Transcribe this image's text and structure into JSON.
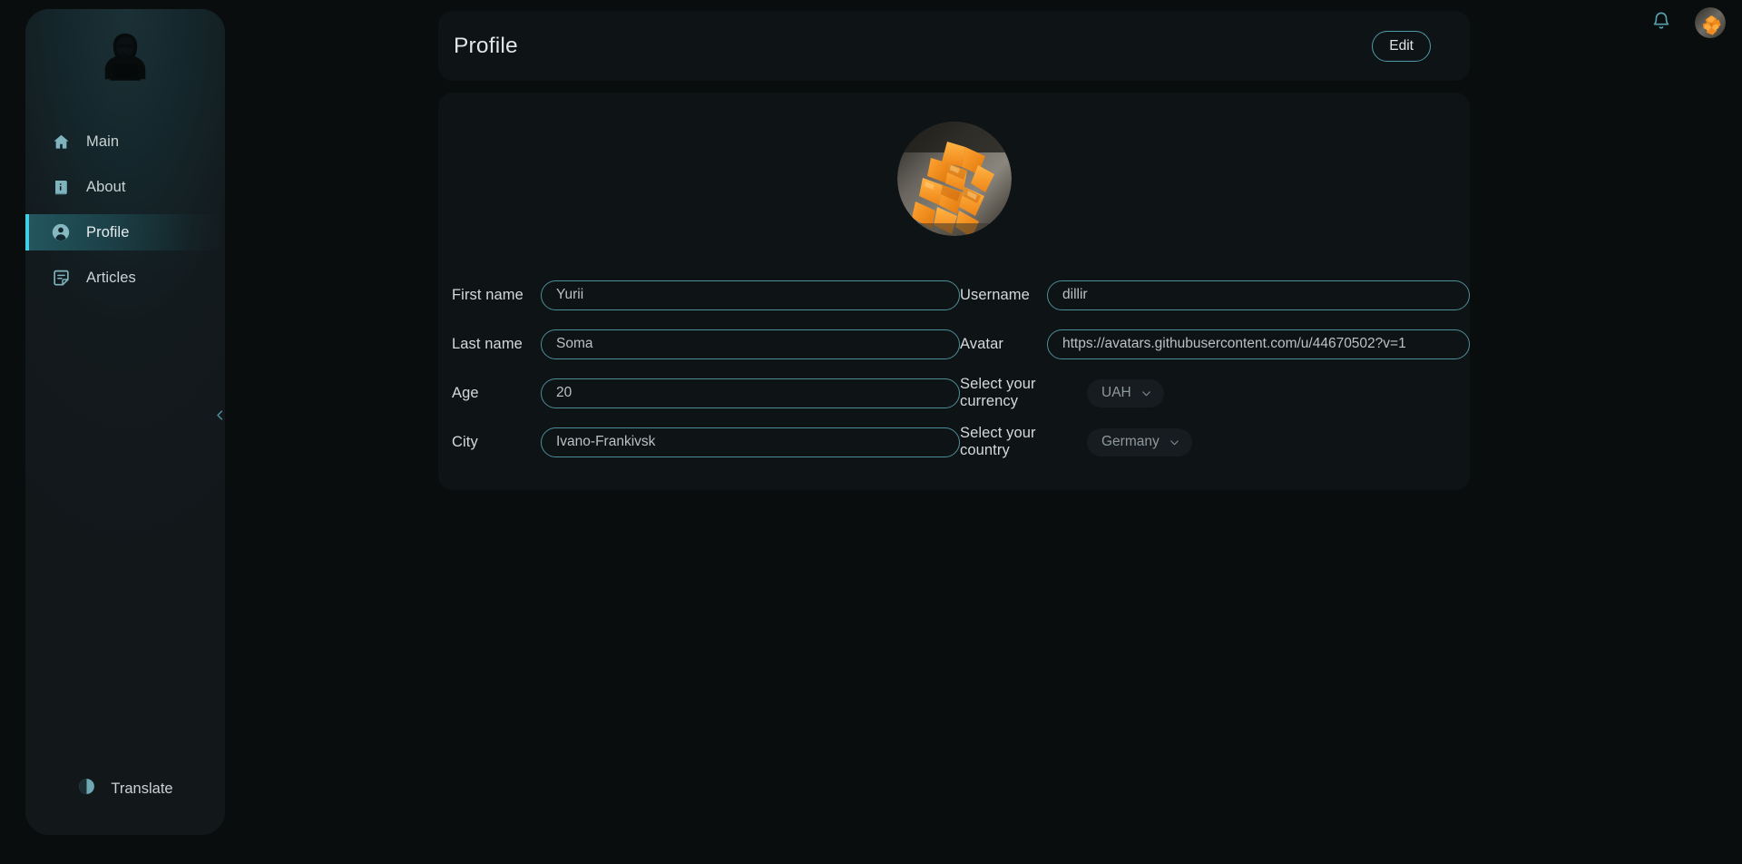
{
  "theme": {
    "bg": "#0a0d0e",
    "card_bg": "#0e1315",
    "accent": "#4e9aa8",
    "accent_bright": "#3fd0e8",
    "input_border": "#4e8e99",
    "text": "#dfe6e8",
    "muted_text": "#8e999c"
  },
  "sidebar": {
    "logo_icon": "hacker-hoodie-laptop-icon",
    "items": [
      {
        "label": "Main",
        "icon": "home-icon",
        "active": false
      },
      {
        "label": "About",
        "icon": "info-book-icon",
        "active": false
      },
      {
        "label": "Profile",
        "icon": "user-circle-icon",
        "active": true
      },
      {
        "label": "Articles",
        "icon": "article-note-icon",
        "active": false
      }
    ],
    "collapse_icon": "chevron-left-icon",
    "translate": {
      "label": "Translate",
      "icon": "half-circle-contrast-icon"
    }
  },
  "topbar": {
    "bell_icon": "bell-icon",
    "avatar_icon": "user-avatar-mango-image"
  },
  "header": {
    "title": "Profile",
    "edit_label": "Edit"
  },
  "profile": {
    "avatar_alt": "mango-cubes-avatar-image",
    "left_fields": [
      {
        "label": "First name",
        "value": "Yurii",
        "name": "first-name"
      },
      {
        "label": "Last name",
        "value": "Soma",
        "name": "last-name"
      },
      {
        "label": "Age",
        "value": "20",
        "name": "age"
      },
      {
        "label": "City",
        "value": "Ivano-Frankivsk",
        "name": "city"
      }
    ],
    "right_fields": [
      {
        "label": "Username",
        "value": "dillir",
        "name": "username"
      },
      {
        "label": "Avatar",
        "value": "https://avatars.githubusercontent.com/u/44670502?v=1",
        "name": "avatar-url"
      }
    ],
    "selects": [
      {
        "label": "Select your currency",
        "value": "UAH",
        "name": "currency"
      },
      {
        "label": "Select your country",
        "value": "Germany",
        "name": "country"
      }
    ]
  }
}
